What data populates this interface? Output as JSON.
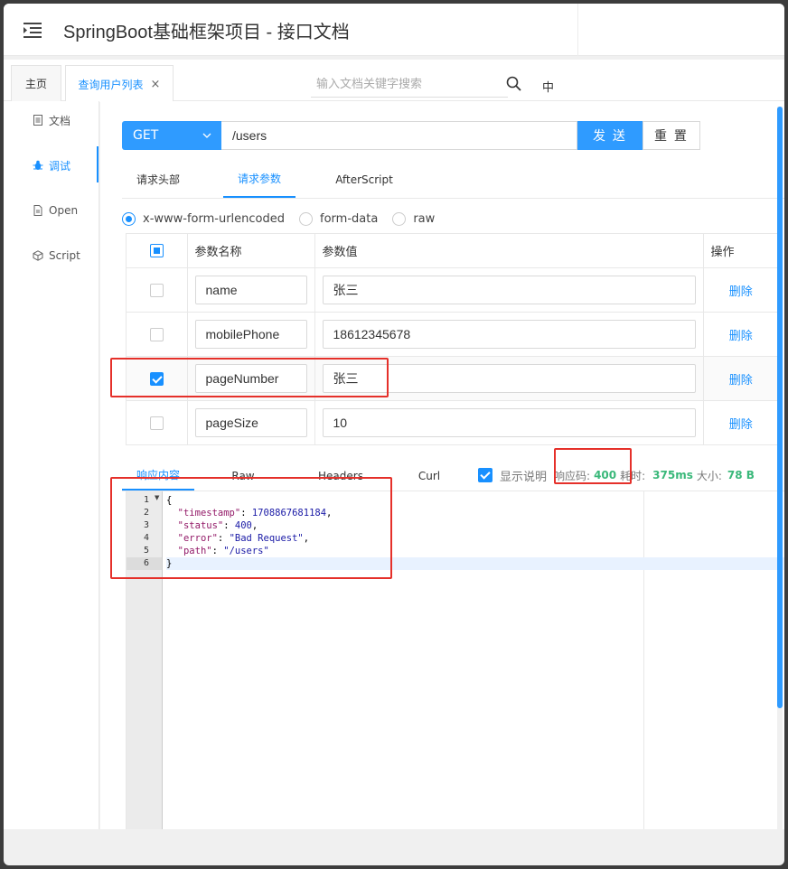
{
  "app": {
    "title": "SpringBoot基础框架项目 - 接口文档"
  },
  "tabs": [
    {
      "label": "主页"
    },
    {
      "label": "查询用户列表",
      "close": "×"
    }
  ],
  "search": {
    "placeholder": "输入文档关键字搜索",
    "lang": "中"
  },
  "sidebar": {
    "items": [
      {
        "label": "文档",
        "icon": "document-icon"
      },
      {
        "label": "调试",
        "icon": "bug-icon",
        "active": true
      },
      {
        "label": "Open",
        "icon": "file-icon"
      },
      {
        "label": "Script",
        "icon": "code-icon"
      }
    ]
  },
  "request": {
    "method": "GET",
    "url": "/users",
    "send_label": "发 送",
    "reset_label": "重 置",
    "tabs": [
      "请求头部",
      "请求参数",
      "AfterScript"
    ],
    "active_tab": "请求参数",
    "body_types": [
      "x-www-form-urlencoded",
      "form-data",
      "raw"
    ],
    "selected_body_type": "x-www-form-urlencoded"
  },
  "params": {
    "headers": {
      "name": "参数名称",
      "value": "参数值",
      "action": "操作"
    },
    "delete_label": "删除",
    "rows": [
      {
        "name": "name",
        "value": "张三",
        "checked": false
      },
      {
        "name": "mobilePhone",
        "value": "18612345678",
        "checked": false
      },
      {
        "name": "pageNumber",
        "value": "张三",
        "checked": true
      },
      {
        "name": "pageSize",
        "value": "10",
        "checked": false
      }
    ]
  },
  "response": {
    "tabs": [
      "响应内容",
      "Raw",
      "Headers",
      "Curl"
    ],
    "active_tab": "响应内容",
    "show_desc_label": "显示说明",
    "status_label": "响应码:",
    "status_value": "400",
    "time_label": "耗时:",
    "time_value": "375ms",
    "size_label": "大小:",
    "size_value": "78 B",
    "body_lines": [
      "{",
      "  \"timestamp\": 1708867681184,",
      "  \"status\": 400,",
      "  \"error\": \"Bad Request\",",
      "  \"path\": \"/users\"",
      "}"
    ],
    "body": {
      "timestamp": "1708867681184",
      "status": "400",
      "error": "\"Bad Request\"",
      "path": "\"/users\""
    }
  },
  "colors": {
    "accent": "#1890ff",
    "button": "#2f9bff",
    "status_ok": "#3ab87a",
    "highlight": "#e5302a"
  }
}
